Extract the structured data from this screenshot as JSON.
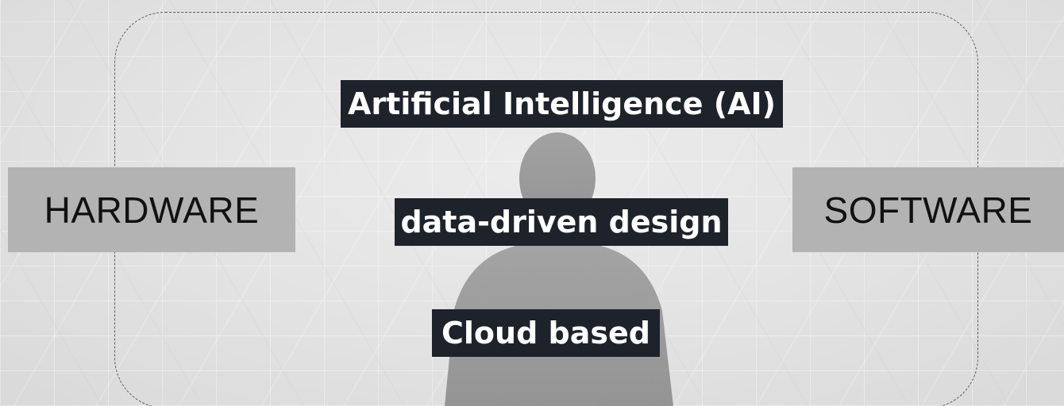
{
  "diagram": {
    "left_block": {
      "label": "HARDWARE"
    },
    "right_block": {
      "label": "SOFTWARE"
    },
    "center_labels": [
      {
        "label": "Artificial Intelligence (AI)"
      },
      {
        "label": "data-driven design"
      },
      {
        "label": "Cloud based"
      }
    ]
  },
  "colors": {
    "label_background": "#1e222a",
    "label_text": "#ffffff",
    "side_block_background": "#b3b3b3",
    "side_block_text": "#111111",
    "frame_stroke": "#5a5a5a"
  }
}
